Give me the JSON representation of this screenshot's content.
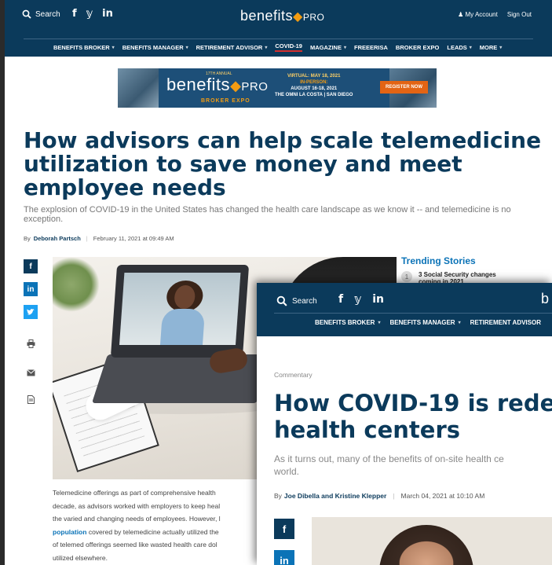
{
  "page1": {
    "header": {
      "search_label": "Search",
      "social": [
        "f",
        "𝕪",
        "in"
      ],
      "logo_main": "benefits",
      "logo_pro": "PRO",
      "my_account": "My Account",
      "sign_out": "Sign Out",
      "nav": [
        {
          "label": "BENEFITS BROKER",
          "dropdown": true
        },
        {
          "label": "BENEFITS MANAGER",
          "dropdown": true
        },
        {
          "label": "RETIREMENT ADVISOR",
          "dropdown": true
        },
        {
          "label": "COVID-19",
          "dropdown": false,
          "active": true
        },
        {
          "label": "MAGAZINE",
          "dropdown": true
        },
        {
          "label": "FREEERISA",
          "dropdown": false
        },
        {
          "label": "BROKER EXPO",
          "dropdown": false
        },
        {
          "label": "LEADS",
          "dropdown": true
        },
        {
          "label": "MORE",
          "dropdown": true
        }
      ]
    },
    "banner": {
      "annual": "17TH ANNUAL",
      "logo_main": "benefits",
      "logo_pro": "PRO",
      "sub": "BROKER EXPO",
      "virtual": "VIRTUAL: MAY 18, 2021",
      "in_person": "IN-PERSON:",
      "dates": "AUGUST 16-18, 2021",
      "venue": "THE OMNI LA COSTA | SAN DIEGO",
      "cta": "REGISTER NOW"
    },
    "article": {
      "title": "How advisors can help scale telemedicine utilization to save money and meet employee needs",
      "deck": "The explosion of COVID-19 in the United States has changed the health care landscape as we know it -- and telemedicine is no exception.",
      "by": "By",
      "author": "Deborah Partsch",
      "date": "February 11, 2021 at 09:49 AM",
      "body": [
        "Telemedicine  offerings as part of comprehensive health",
        "decade, as advisors worked with employers to keep heal",
        "the varied and changing needs of employees. However, l",
        "covered by telemedicine actually utilized the",
        "of telemed offerings seemed like wasted health care dol",
        "utilized elsewhere."
      ],
      "body_link": "population"
    },
    "trending": {
      "title": "Trending Stories",
      "items": [
        {
          "num": "1",
          "text": "3 Social Security changes",
          "text2": "coming in 2021"
        }
      ]
    }
  },
  "page2": {
    "header": {
      "search_label": "Search",
      "social": [
        "f",
        "𝕪",
        "in"
      ],
      "logo_partial": "b",
      "nav": [
        {
          "label": "BENEFITS BROKER"
        },
        {
          "label": "BENEFITS MANAGER"
        },
        {
          "label": "RETIREMENT ADVISOR"
        }
      ]
    },
    "article": {
      "kicker": "Commentary",
      "title_line1": "How COVID-19 is rede",
      "title_line2": "health centers",
      "deck_line1": "As it turns out, many of the benefits of on-site health ce",
      "deck_line2": "world.",
      "by": "By",
      "author": "Joe Dibella and Kristine Klepper",
      "date": "March 04, 2021 at 10:10 AM"
    }
  },
  "colors": {
    "navy": "#0b3a5b",
    "linkedin": "#0b73b7",
    "twitter": "#1da1f2",
    "accent_orange": "#f39c12",
    "active_red": "#d32f2f"
  }
}
